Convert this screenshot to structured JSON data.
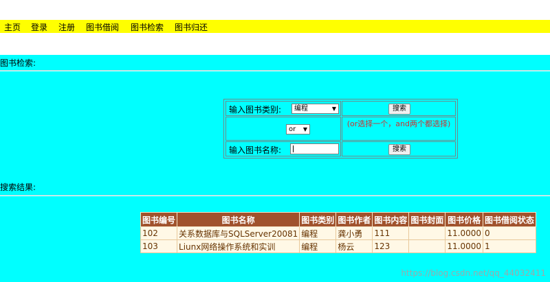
{
  "nav": {
    "items": [
      {
        "label": "主页"
      },
      {
        "label": "登录"
      },
      {
        "label": "注册"
      },
      {
        "label": "图书借阅"
      },
      {
        "label": "图书检索"
      },
      {
        "label": "图书归还"
      }
    ]
  },
  "search_section": {
    "title": "图书检索:",
    "category_label": "输入图书类别:",
    "category_value": "编程",
    "search_button": "搜索",
    "operator_value": "or",
    "note": "(or选择一个，and两个都选择)",
    "name_label": "输入图书名称:",
    "name_value": "",
    "search_button2": "搜索"
  },
  "results_section": {
    "title": "搜索结果:",
    "columns": [
      "图书编号",
      "图书名称",
      "图书类别",
      "图书作者",
      "图书内容",
      "图书封面",
      "图书价格",
      "图书借阅状态"
    ],
    "rows": [
      [
        "102",
        "关系数据库与SQLServer20081",
        "编程",
        "龚小勇",
        "111",
        "",
        "11.0000",
        "0"
      ],
      [
        "103",
        "Liunx网络操作系统和实训",
        "编程",
        "杨云",
        "123",
        "",
        "11.0000",
        "1"
      ]
    ]
  },
  "watermark": "https://blog.csdn.net/qq_44032411"
}
